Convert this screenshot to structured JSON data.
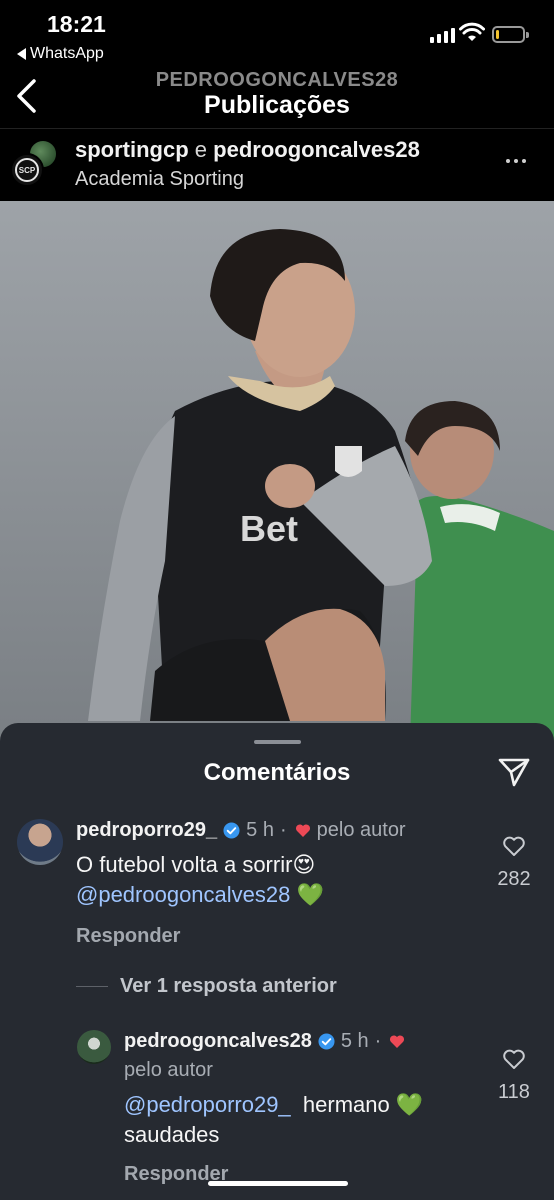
{
  "status_bar": {
    "time": "18:21",
    "back_app": "WhatsApp",
    "icons": [
      "signal-icon",
      "wifi-icon",
      "battery-icon"
    ],
    "battery_level": 0.12,
    "battery_color": "#f4c430"
  },
  "header": {
    "username": "PEDROOGONCALVES28",
    "title": "Publicações"
  },
  "post": {
    "author_1": "sportingcp",
    "joiner": "e",
    "author_2": "pedroogoncalves28",
    "location": "Academia Sporting",
    "crest_text": "SCP"
  },
  "comments_sheet": {
    "title": "Comentários",
    "view_replies": "Ver 1 resposta anterior",
    "comments": [
      {
        "username": "pedroporro29_",
        "time": "5 h",
        "liked_by_author": "pelo autor",
        "text_line1": "O futebol volta a sorrir😍",
        "mention": "@pedroogoncalves28",
        "emoji": "💚",
        "reply_label": "Responder",
        "likes": "282"
      },
      {
        "username": "pedroogoncalves28",
        "time": "5 h",
        "liked_by_author": "pelo autor",
        "mention": "@pedroporro29_",
        "text_after_mention": "hermano",
        "emoji": "💚",
        "text_line2": "saudades",
        "reply_label": "Responder",
        "likes": "118"
      }
    ]
  },
  "colors": {
    "sheet_bg": "#262a31",
    "mention": "#9fc5ff",
    "verified": "#3897f0",
    "heart": "#ed4956"
  }
}
